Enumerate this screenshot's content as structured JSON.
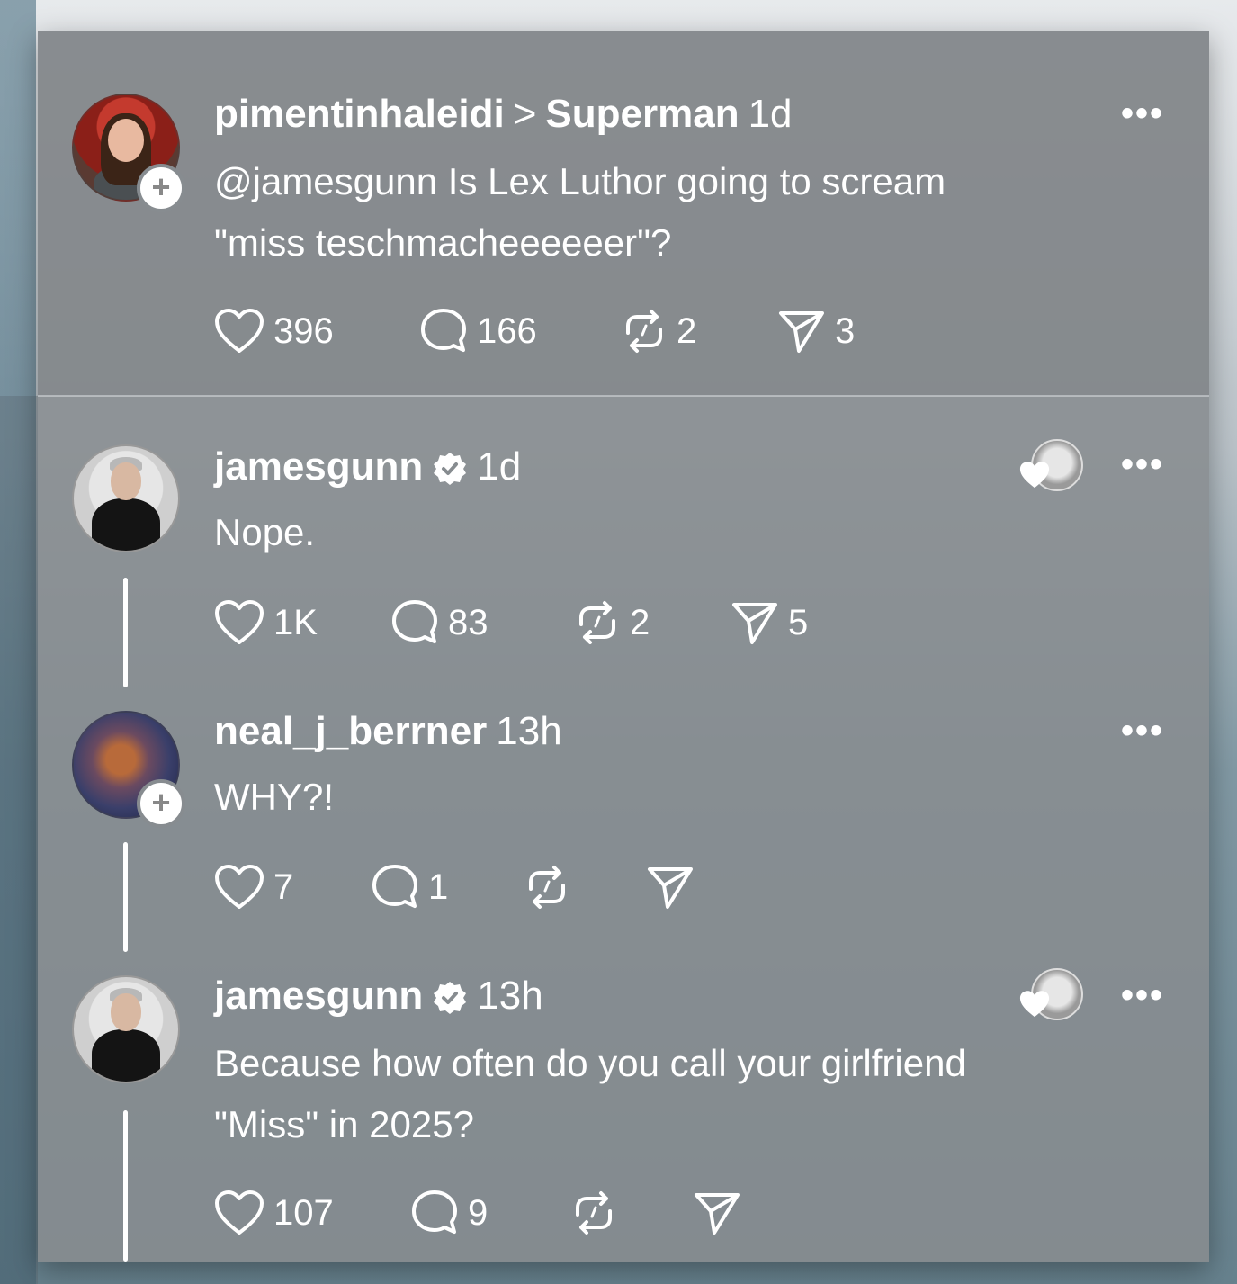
{
  "posts": [
    {
      "user": "pimentinhaleidi",
      "separator": ">",
      "topic": "Superman",
      "time": "1d",
      "text_line1": "@jamesgunn Is Lex Luthor going to scream",
      "text_line2": "\"miss teschmacheeeeeer\"?",
      "likes": "396",
      "replies": "166",
      "reposts": "2",
      "shares": "3",
      "more": "•••"
    },
    {
      "user": "jamesgunn",
      "verified": true,
      "time": "1d",
      "text_line1": "Nope.",
      "likes": "1K",
      "replies": "83",
      "reposts": "2",
      "shares": "5",
      "more": "•••"
    },
    {
      "user": "neal_j_berrner",
      "time": "13h",
      "text_line1": "WHY?!",
      "likes": "7",
      "replies": "1",
      "more": "•••"
    },
    {
      "user": "jamesgunn",
      "verified": true,
      "time": "13h",
      "text_line1": "Because how often do you call your girlfriend",
      "text_line2": "\"Miss\" in 2025?",
      "likes": "107",
      "replies": "9",
      "more": "•••"
    }
  ],
  "colors": {
    "panel": "#878c90",
    "text": "#ffffff",
    "divider": "#d2d6d9"
  },
  "icons": [
    "heart-icon",
    "comment-icon",
    "repost-icon",
    "send-icon",
    "more-icon",
    "verified-icon",
    "follow-plus-icon"
  ]
}
